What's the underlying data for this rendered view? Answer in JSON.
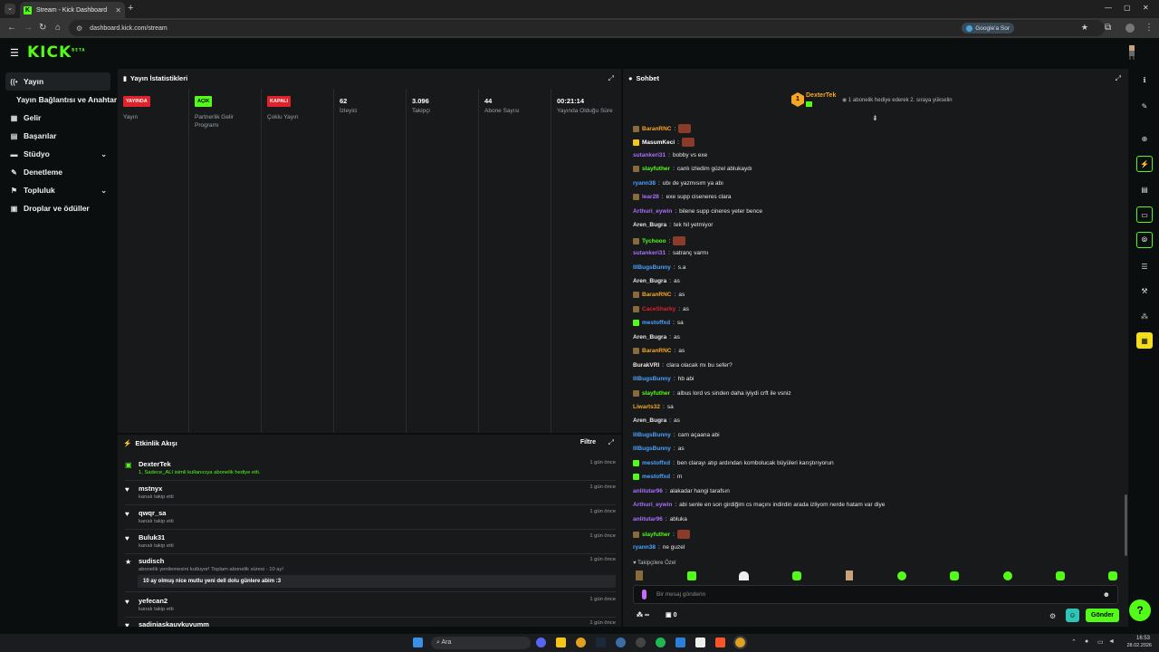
{
  "browser": {
    "tab_title": "Stream - Kick Dashboard",
    "new_tab": "+",
    "url": "dashboard.kick.com/stream",
    "ask_google": "Google'a Sor",
    "min": "—",
    "max": "▢",
    "close": "✕"
  },
  "kick": {
    "logo": "KICK",
    "logo_sup": "BETA"
  },
  "sidebar": {
    "items": [
      {
        "label": "Yayın",
        "icon": "broadcast-icon"
      },
      {
        "label": "Yayın Bağlantısı ve Anahtarı",
        "icon": "key-icon"
      },
      {
        "label": "Gelir",
        "icon": "revenue-icon"
      },
      {
        "label": "Başarılar",
        "icon": "trophy-icon"
      },
      {
        "label": "Stüdyo",
        "icon": "studio-icon"
      },
      {
        "label": "Denetleme",
        "icon": "wrench-icon"
      },
      {
        "label": "Topluluk",
        "icon": "community-icon"
      },
      {
        "label": "Droplar ve ödüller",
        "icon": "gift-icon"
      }
    ]
  },
  "stats": {
    "title": "Yayın İstatistikleri",
    "cols": [
      {
        "badge": "YAYINDA",
        "label": "Yayın",
        "badge_color": "#e0222b"
      },
      {
        "badge": "AÇIK",
        "label": "Partnerlik Gelir Programı",
        "badge_color": "#53fc18"
      },
      {
        "badge": "KAPALI",
        "label": "Çoklu Yayın",
        "badge_color": "#e0222b"
      },
      {
        "value": "62",
        "label": "İzleyici"
      },
      {
        "value": "3.096",
        "label": "Takipçi"
      },
      {
        "value": "44",
        "label": "Abone Sayısı"
      },
      {
        "value": "00:21:14",
        "label": "Yayında Olduğu Süre"
      }
    ]
  },
  "events": {
    "title": "Etkinlik Akışı",
    "filter": "Filtre",
    "items": [
      {
        "name": "DexterTek",
        "sub": "1, Sadece_ALI isimli kullanıcıya abonelik hediye etti.",
        "time": "1 gün önce",
        "icon": "gift-icon"
      },
      {
        "name": "mstnyx",
        "sub": "kanalı takip etti",
        "time": "1 gün önce",
        "icon": "heart-icon"
      },
      {
        "name": "qwqr_sa",
        "sub": "kanalı takip etti",
        "time": "1 gün önce",
        "icon": "heart-icon"
      },
      {
        "name": "Buluk31",
        "sub": "kanalı takip etti",
        "time": "1 gün önce",
        "icon": "heart-icon"
      },
      {
        "name": "sudisch",
        "sub": "abonelik yenilemesini kutluyor! Toplam abonelik süresi - 10 ay!",
        "time": "1 gün önce",
        "icon": "star-icon",
        "message": "10 ay olmuş nice mutlu yeni dell dolu günlere abim :3"
      },
      {
        "name": "yefecan2",
        "sub": "kanalı takip etti",
        "time": "1 gün önce",
        "icon": "heart-icon"
      },
      {
        "name": "sadinjaskauvkuvumm",
        "sub": "",
        "time": "1 gün önce",
        "icon": "heart-icon"
      }
    ]
  },
  "chat": {
    "title": "Sohbet",
    "pinned_user": "DexterTek",
    "pinned_rank": "1",
    "pinned_text": "1 abonelik hediye ederek 2. sıraya yükselin",
    "messages": [
      {
        "user": "BaranRNC",
        "text": "",
        "color": "#f5a623",
        "badge": "#8a6a3a",
        "emote": true
      },
      {
        "user": "MasumKeci",
        "text": "",
        "color": "#ffffff",
        "badge": "#f5c518",
        "emote": true
      },
      {
        "user": "sutankeri31",
        "text": "bobby vs exe",
        "color": "#a970ff"
      },
      {
        "user": "slayfuther",
        "text": "canlı izledim güzel ablukaydı",
        "color": "#53fc18",
        "badge": "#8a6a3a"
      },
      {
        "user": "ryann38",
        "text": "ubı de yazmısım ya abı",
        "color": "#4aa3ff"
      },
      {
        "user": "lear28",
        "text": "exe supp ciseneres clara",
        "color": "#a970ff",
        "badge": "#8a6a3a"
      },
      {
        "user": "Arthuri_eywin",
        "text": "bilene supp cineres yeter bence",
        "color": "#a970ff"
      },
      {
        "user": "Aren_Bugra",
        "text": "tek hil yetmiyor",
        "color": "#e8e8e8"
      },
      {
        "user": "Tychooo",
        "text": "",
        "color": "#53fc18",
        "badge": "#8a6a3a",
        "emote": true
      },
      {
        "user": "sutankeri31",
        "text": "satranç varmı",
        "color": "#a970ff"
      },
      {
        "user": "lllBugsBunny",
        "text": "s.a",
        "color": "#4aa3ff"
      },
      {
        "user": "Aren_Bugra",
        "text": "as",
        "color": "#e8e8e8"
      },
      {
        "user": "BaranRNC",
        "text": "as",
        "color": "#f5a623",
        "badge": "#8a6a3a"
      },
      {
        "user": "CaceSharky",
        "text": "as",
        "color": "#e0222b",
        "badge": "#8a6a3a"
      },
      {
        "user": "mestoffxd",
        "text": "sa",
        "color": "#4aa3ff",
        "badge": "#53fc18"
      },
      {
        "user": "Aren_Bugra",
        "text": "as",
        "color": "#e8e8e8"
      },
      {
        "user": "BaranRNC",
        "text": "as",
        "color": "#f5a623",
        "badge": "#8a6a3a"
      },
      {
        "user": "BurakVRI",
        "text": "clara olacak mı bu sefer?",
        "color": "#e8e8e8"
      },
      {
        "user": "lllBugsBunny",
        "text": "hb abi",
        "color": "#4aa3ff"
      },
      {
        "user": "slayfuther",
        "text": "albus lord vs sinden daha iyiydi crft ile vsniz",
        "color": "#53fc18",
        "badge": "#8a6a3a"
      },
      {
        "user": "Liwarts32",
        "text": "sa",
        "color": "#f5a623"
      },
      {
        "user": "Aren_Bugra",
        "text": "as",
        "color": "#e8e8e8"
      },
      {
        "user": "lllBugsBunny",
        "text": "cam açaana abi",
        "color": "#4aa3ff"
      },
      {
        "user": "lllBugsBunny",
        "text": "as",
        "color": "#4aa3ff"
      },
      {
        "user": "mestoffxd",
        "text": "ben clarayı atıp ardından kombolucak büyüleri karıştırıyorun",
        "color": "#4aa3ff",
        "badge": "#53fc18"
      },
      {
        "user": "mestoffxd",
        "text": "m",
        "color": "#4aa3ff",
        "badge": "#53fc18"
      },
      {
        "user": "anlitutar96",
        "text": "alakadar hangi tarafsın",
        "color": "#a970ff"
      },
      {
        "user": "Arthuri_eywin",
        "text": "abi senle en son girdiğim cs maçını indirdin arada izliyom nerde hatam var diye",
        "color": "#a970ff"
      },
      {
        "user": "anlitutar96",
        "text": "abluka",
        "color": "#a970ff"
      },
      {
        "user": "slayfuther",
        "text": "",
        "color": "#53fc18",
        "badge": "#8a6a3a",
        "emote": true
      },
      {
        "user": "ryann38",
        "text": "ne guzel",
        "color": "#4aa3ff"
      }
    ],
    "followers_only": "Takipçilere Özel",
    "input_placeholder": "Bir mesaj gönderin",
    "count_a": "∞",
    "count_b": "0",
    "send": "Gönder"
  },
  "taskbar": {
    "search": "Ara",
    "time": "16:53",
    "date": "28.02.2026"
  }
}
